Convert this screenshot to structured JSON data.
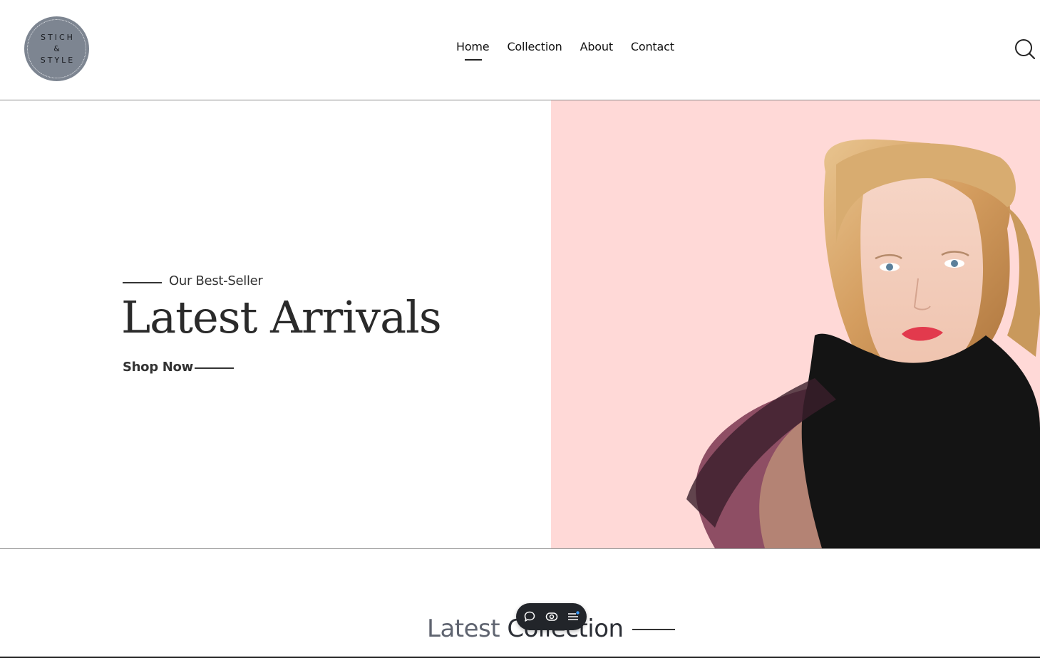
{
  "logo": {
    "line1": "STICH",
    "line2": "&",
    "line3": "STYLE"
  },
  "nav": {
    "items": [
      {
        "label": "Home",
        "active": true
      },
      {
        "label": "Collection",
        "active": false
      },
      {
        "label": "About",
        "active": false
      },
      {
        "label": "Contact",
        "active": false
      }
    ],
    "search_icon": "search-icon"
  },
  "hero": {
    "eyebrow": "Our Best-Seller",
    "title": "Latest Arrivals",
    "cta": "Shop Now",
    "image_background": "#ffd9d7",
    "image_subject": "model-portrait"
  },
  "section": {
    "title_part1": "Latest ",
    "title_part2": "Collection"
  },
  "toolbar": {
    "icons": [
      "chat-icon",
      "eye-icon",
      "menu-icon"
    ]
  },
  "colors": {
    "accent_pink": "#ffd9d7",
    "logo_gray": "#7d8591",
    "notification_blue": "#3b9cff"
  }
}
